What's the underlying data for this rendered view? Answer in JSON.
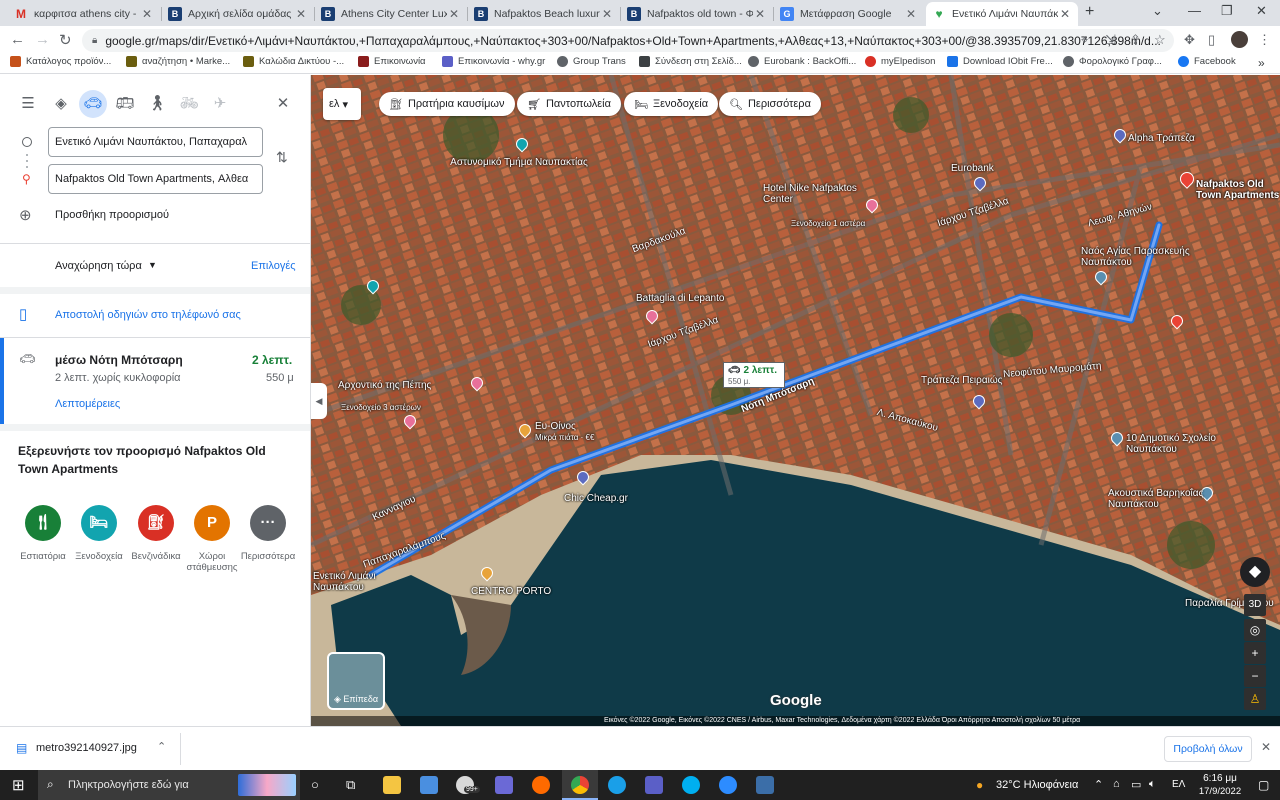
{
  "browser": {
    "tabs": [
      {
        "icon": "gmail-icon",
        "title": "καρφιτσα athens city -"
      },
      {
        "icon": "booking-icon",
        "title": "Αρχική σελίδα ομάδας κ"
      },
      {
        "icon": "booking-icon",
        "title": "Athens City Center Luxury"
      },
      {
        "icon": "booking-icon",
        "title": "Nafpaktos Beach luxury S"
      },
      {
        "icon": "booking-icon",
        "title": "Nafpaktos old town - Φωτ"
      },
      {
        "icon": "translate-icon",
        "title": "Μετάφραση Google"
      },
      {
        "icon": "maps-pin-icon",
        "title": "Ενετικό Λιμάνι Ναυπάκτο",
        "active": true
      }
    ],
    "url": "google.gr/maps/dir/Ενετικό+Λιμάνι+Ναυπάκτου,+Παπαχαραλάμπους,+Ναύπακτος+303+00/Nafpaktos+Old+Town+Apartments,+Αλθεας+13,+Ναύπακτος+303+00/@38.3935709,21.8307126,398m/d...",
    "bookmarks": [
      "Κατάλογος προϊόν...",
      "αναζήτηση • Marke...",
      "Καλώδια Δικτύου -...",
      "Επικοινωνία",
      "Επικοινωνία - why.gr",
      "Group Trans",
      "Σύνδεση στη Σελίδ...",
      "Eurobank : BackOffi...",
      "myElpedison",
      "Download IObit Fre...",
      "Φορολογικό Γραφ...",
      "Facebook"
    ]
  },
  "sidebar": {
    "origin": "Ενετικό Λιμάνι Ναυπάκτου, Παπαχαραλ",
    "destination": "Nafpaktos Old Town Apartments, Αλθεα",
    "add_destination": "Προσθήκη προορισμού",
    "depart": "Αναχώρηση τώρα",
    "options": "Επιλογές",
    "send_to_phone": "Αποστολή οδηγιών στο τηλέφωνό σας",
    "route": {
      "via": "μέσω Νότη Μπότσαρη",
      "time": "2 λεπτ.",
      "detail": "2 λεπτ. χωρίς κυκλοφορία",
      "distance": "550 μ",
      "details_link": "Λεπτομέρειες"
    },
    "explore_title": "Εξερευνήστε τον προορισμό Nafpaktos Old Town Apartments",
    "categories": [
      {
        "label": "Εστιατόρια",
        "color": "#188038",
        "icon": "fork-knife-icon"
      },
      {
        "label": "Ξενοδοχεία",
        "color": "#12a4af",
        "icon": "bed-icon"
      },
      {
        "label": "Βενζινάδικα",
        "color": "#d93025",
        "icon": "fuel-icon"
      },
      {
        "label": "Χώροι στάθμευσης",
        "color": "#e37400",
        "icon": "parking-icon"
      },
      {
        "label": "Περισσότερα",
        "color": "#5f6368",
        "icon": "more-icon"
      }
    ]
  },
  "map": {
    "chips": [
      {
        "icon": "fuel-icon",
        "label": "Πρατήρια καυσίμων"
      },
      {
        "icon": "cart-icon",
        "label": "Παντοπωλεία"
      },
      {
        "icon": "bed-icon",
        "label": "Ξενοδοχεία"
      },
      {
        "icon": "search-icon",
        "label": "Περισσότερα"
      }
    ],
    "lang_button": "ελ",
    "route_callout": {
      "time": "2 λεπτ.",
      "distance": "550 μ."
    },
    "labels": [
      "Αστυνομικό Τμήμα Ναυπακτίας",
      "Hotel Nike Nafpaktos Center",
      "Ξενοδοχείο 1 αστέρα",
      "Eurobank",
      "Alpha Τράπεζα",
      "Nafpaktos Old Town Apartments",
      "Ναός Αγίας Παρασκευής Ναυπάκτου",
      "Λεωφ. Αθηνών",
      "Ιάρχου Τζαβέλλα",
      "Βαρδακούλα",
      "Battaglia di Lepanto",
      "Νότη Μπότσαρη",
      "Νεοφύτου Μαυρομάτη",
      "Τράπεζα Πειραιώς",
      "Λ. Αποκαύκου",
      "10 Δημοτικό Σχολείο Ναυπάκτου",
      "Ακουστικά Βαρηκοΐας Ναυπάκτου",
      "Ευ-Οίνος",
      "Μικρά πιάτα · €€",
      "Chic Cheap.gr",
      "CENTRO PORTO",
      "Ενετικό Λιμάνι Ναυπάκτου",
      "Παραλία Γρίμπαβου",
      "Αρχοντικό της Πέπης",
      "Ξενοδοχείο 3 αστέρων",
      "Παπαχαραλάμπους",
      "Κανναγιου"
    ],
    "layers": "Επίπεδα",
    "google": "Google",
    "attribution": "Εικόνες ©2022 Google, Εικόνες ©2022 CNES / Airbus, Maxar Technologies, Δεδομένα χάρτη ©2022    Ελλάδα    Όροι    Απόρρητο    Αποστολή σχολίων    50 μέτρα",
    "view_3d": "3D"
  },
  "downloads": {
    "file": "metro392140927.jpg",
    "show_all": "Προβολή όλων"
  },
  "taskbar": {
    "search": "Πληκτρολογήστε εδώ για",
    "weather": "32°C Ηλιοφάνεια",
    "lang": "ΕΛ",
    "time": "6:16 μμ",
    "date": "17/9/2022",
    "badge": "99+"
  }
}
